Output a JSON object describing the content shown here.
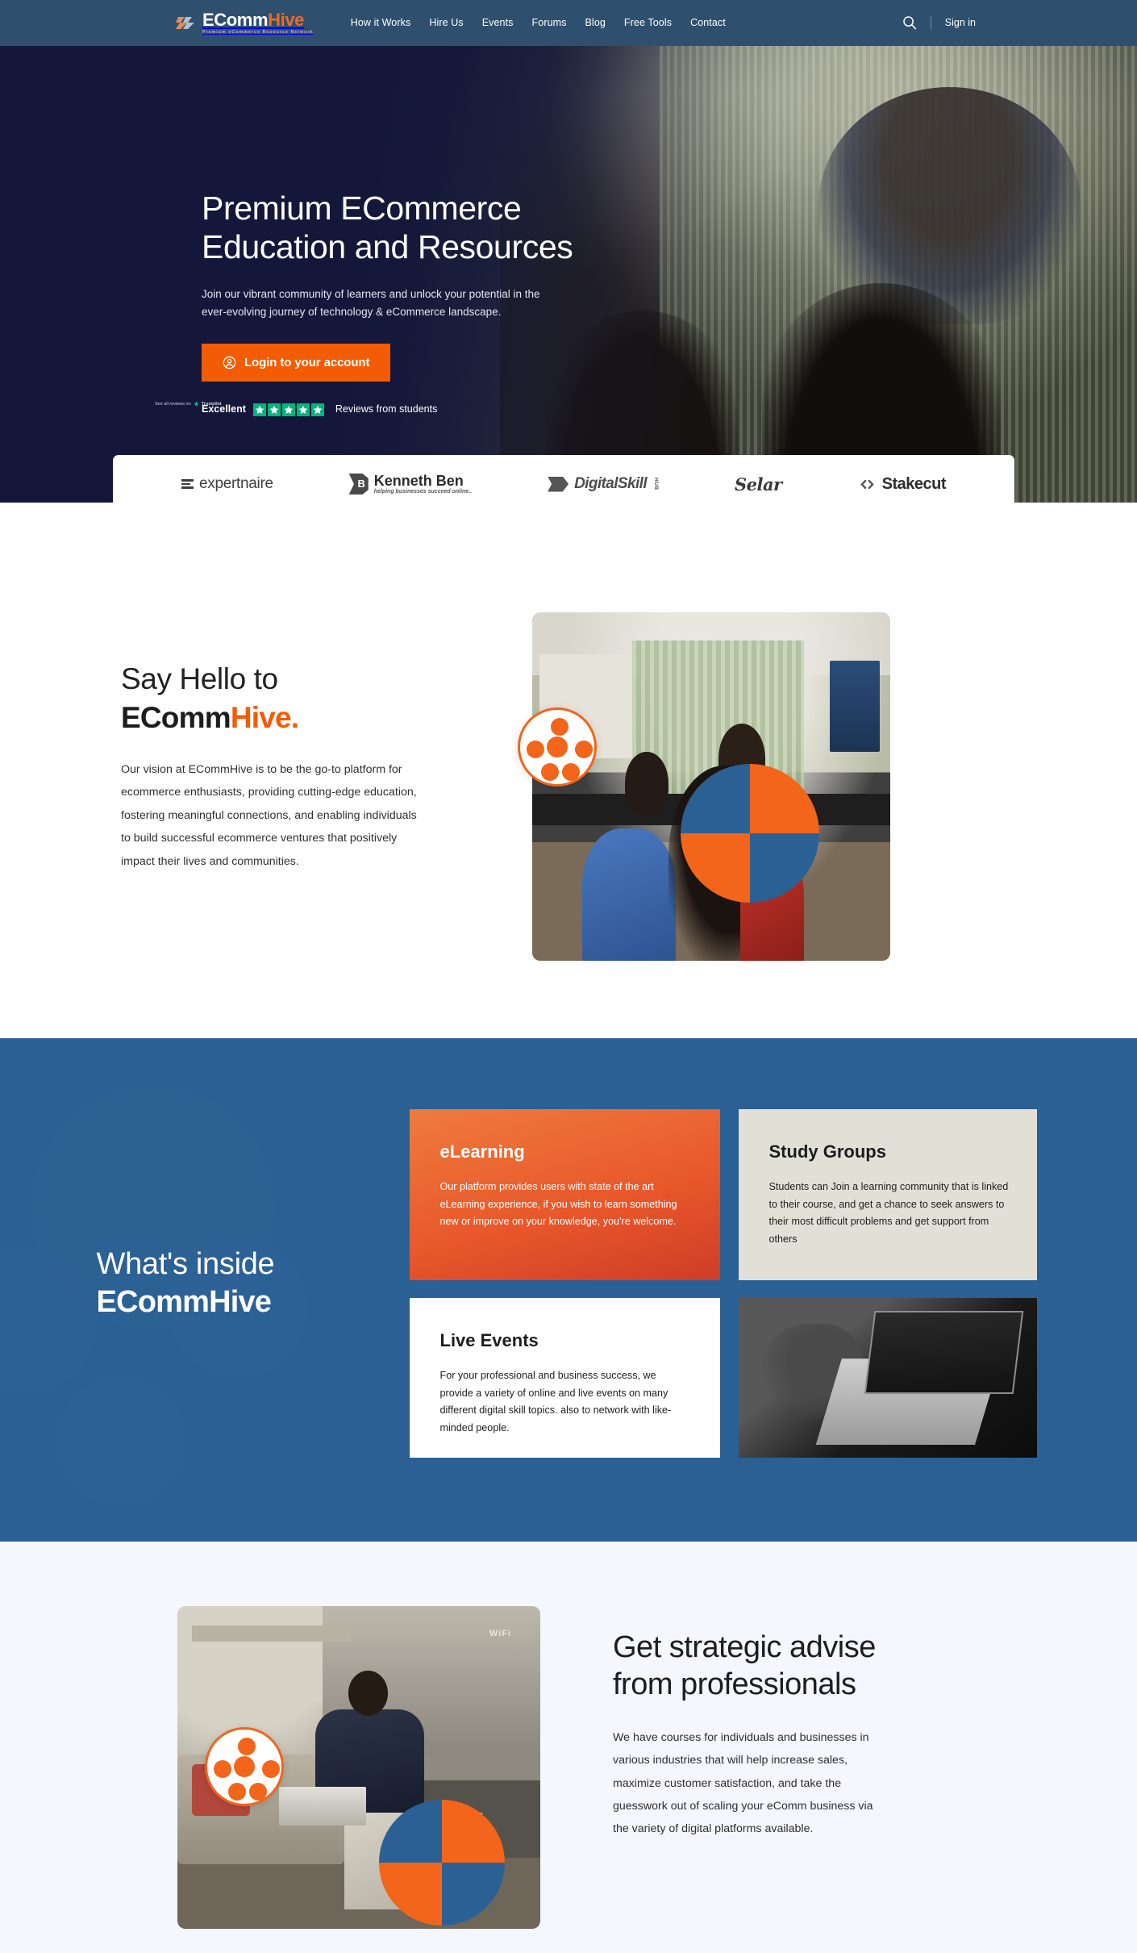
{
  "header": {
    "logo": {
      "text_main": "EComm",
      "text_accent": "Hive",
      "tagline": "Premium eCommerce Resource Network"
    },
    "nav": [
      {
        "label": "How it Works"
      },
      {
        "label": "Hire Us"
      },
      {
        "label": "Events"
      },
      {
        "label": "Forums"
      },
      {
        "label": "Blog"
      },
      {
        "label": "Free Tools"
      },
      {
        "label": "Contact"
      }
    ],
    "search_icon": "search-icon",
    "signin_label": "Sign in"
  },
  "hero": {
    "heading_line1": "Premium ECommerce",
    "heading_line2": "Education and Resources",
    "paragraph": "Join our vibrant community of learners and unlock your potential in the ever-evolving journey of technology & eCommerce landscape.",
    "cta_label": "Login to your account",
    "cta_icon": "user-circle-icon",
    "cta_color": "#f25c05",
    "trustpilot": {
      "rating_word": "Excellent",
      "stars": 5,
      "star_color": "#00b67a",
      "reviews_label": "Reviews from students",
      "fineprint": "See all reviews on",
      "brand": "Trustpilot"
    }
  },
  "partners": [
    {
      "name": "expertnaire",
      "icon": "expertnaire-bars-icon"
    },
    {
      "name": "Kenneth Ben",
      "tagline": "helping businesses succeed online..",
      "icon": "kennethben-mark-icon"
    },
    {
      "name": "DigitalSkill",
      "suffix": "HUB",
      "icon": "digitalskill-arrow-icon"
    },
    {
      "name": "Selar",
      "icon": "selar-script-icon"
    },
    {
      "name": "Stakecut",
      "icon": "stakecut-code-icon"
    }
  ],
  "hello": {
    "heading_line1": "Say Hello to",
    "heading_line2_main": "EComm",
    "heading_line2_accent": "Hive.",
    "accent_color": "#f25c05",
    "paragraph": "Our vision at ECommHive is to be the go-to platform for ecommerce enthusiasts, providing cutting-edge education, fostering meaningful connections, and enabling individuals to build successful ecommerce ventures that positively impact their lives and communities."
  },
  "inside": {
    "title_line1": "What's inside",
    "title_line2": "ECommHive",
    "background_color": "#2b6094",
    "cards": [
      {
        "title": "eLearning",
        "body": "Our platform provides users with state of the art eLearning experience, if you wish to learn something new or improve on your knowledge, you're welcome.",
        "style": "orange-gradient"
      },
      {
        "title": "Study Groups",
        "body": "Students can Join a learning community that is linked to their course, and get a chance to seek answers to their most difficult problems and get support from others",
        "style": "beige"
      },
      {
        "title": "Live Events",
        "body": "For your professional and business success, we provide a variety of online and live events on many different digital skill topics. also to network with like-minded people.",
        "style": "white"
      },
      {
        "title": "",
        "body": "",
        "style": "photo",
        "alt": "hands typing on a laptop, black and white photo"
      }
    ]
  },
  "strategic": {
    "heading": "Get strategic advise from professionals",
    "paragraph": "We have courses for individuals and businesses in various industries that will help increase sales, maximize customer satisfaction, and take the guesswork out of scaling your eComm business via the variety of digital platforms available.",
    "photo_alt": "man working on a laptop in a lounge",
    "wifi_label": "WiFi"
  }
}
